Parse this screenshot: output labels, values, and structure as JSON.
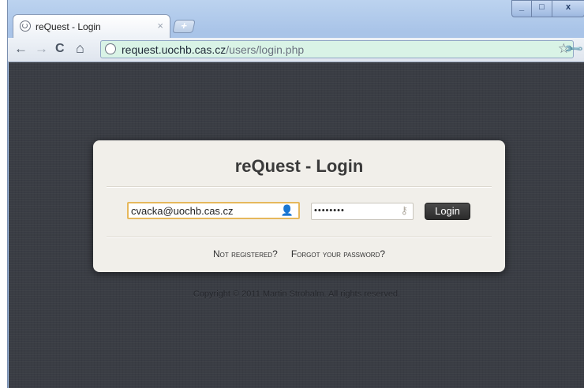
{
  "browser": {
    "tab": {
      "title": "reQuest - Login",
      "close_glyph": "×",
      "favicon_icon": "globe-icon"
    },
    "new_tab_glyph": "+",
    "window_controls": {
      "minimize": "_",
      "maximize": "□",
      "close": "x"
    },
    "toolbar": {
      "back_glyph": "←",
      "forward_glyph": "→",
      "reload_glyph": "C",
      "home_glyph": "⌂",
      "url_host": "request.uochb.cas.cz",
      "url_path": "/users/login.php",
      "bookmark_glyph": "☆",
      "menu_glyph": "🔧"
    }
  },
  "login": {
    "title": "reQuest - Login",
    "email_value": "cvacka@uochb.cas.cz",
    "email_icon": "user-icon",
    "password_value": "••••••••",
    "password_icon": "key-icon",
    "login_label": "Login",
    "not_registered": "Not registered?",
    "forgot_password": "Forgot your password?"
  },
  "footer": {
    "copyright": "Copyright © 2011 Martin Strohalm. All rights reserved."
  },
  "colors": {
    "page_bg": "#3a3d44",
    "card_bg": "#f1efea",
    "focus_border": "#e6b85c",
    "omnibox_bg": "#d9f3e6"
  }
}
